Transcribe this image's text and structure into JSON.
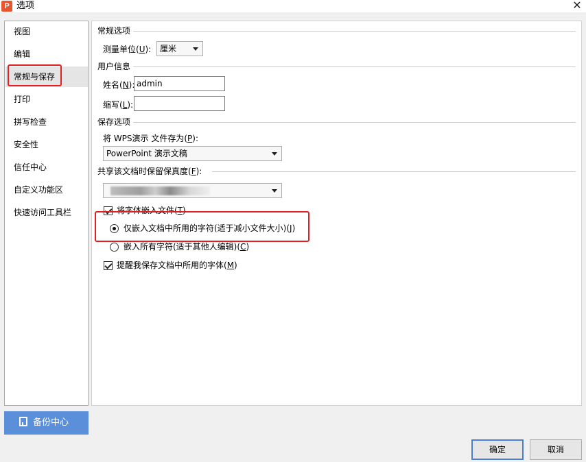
{
  "window": {
    "title": "选项",
    "app_icon_glyph": "P"
  },
  "sidebar": {
    "items": [
      {
        "label": "视图"
      },
      {
        "label": "编辑"
      },
      {
        "label": "常规与保存"
      },
      {
        "label": "打印"
      },
      {
        "label": "拼写检查"
      },
      {
        "label": "安全性"
      },
      {
        "label": "信任中心"
      },
      {
        "label": "自定义功能区"
      },
      {
        "label": "快速访问工具栏"
      }
    ],
    "selected_index": 2,
    "backup_label": "备份中心"
  },
  "general": {
    "section_title": "常规选项",
    "unit_label": "测量单位(",
    "unit_key": "U",
    "unit_label_end": "):",
    "unit_value": "厘米"
  },
  "user_info": {
    "section_title": "用户信息",
    "name_label": "姓名(",
    "name_key": "N",
    "name_label_end": "):",
    "name_value": "admin",
    "initials_label": "缩写(",
    "initials_key": "L",
    "initials_label_end": "):",
    "initials_value": ""
  },
  "save": {
    "section_title": "保存选项",
    "save_as_label": "将 WPS演示 文件存为(",
    "save_as_key": "P",
    "save_as_label_end": "):",
    "save_as_value": "PowerPoint 演示文稿"
  },
  "fidelity": {
    "section_title": "共享该文档时保留保真度(",
    "section_key": "F",
    "section_title_end": "):",
    "embed_fonts_label": "将字体嵌入文件(",
    "embed_fonts_key": "T",
    "embed_fonts_end": ")",
    "embed_fonts_checked": true,
    "radio_used_label": "仅嵌入文档中所用的字符(适于减小文件大小)(",
    "radio_used_key": "J",
    "radio_used_end": ")",
    "radio_all_label": "嵌入所有字符(适于其他人编辑)(",
    "radio_all_key": "C",
    "radio_all_end": ")",
    "selected_radio": "used",
    "remind_label": "提醒我保存文档中所用的字体(",
    "remind_key": "M",
    "remind_end": ")",
    "remind_checked": true
  },
  "buttons": {
    "ok": "确定",
    "cancel": "取消"
  },
  "colors": {
    "highlight": "#e02020",
    "backup_bg": "#5b8fd9",
    "primary_border": "#4a7fcf"
  }
}
